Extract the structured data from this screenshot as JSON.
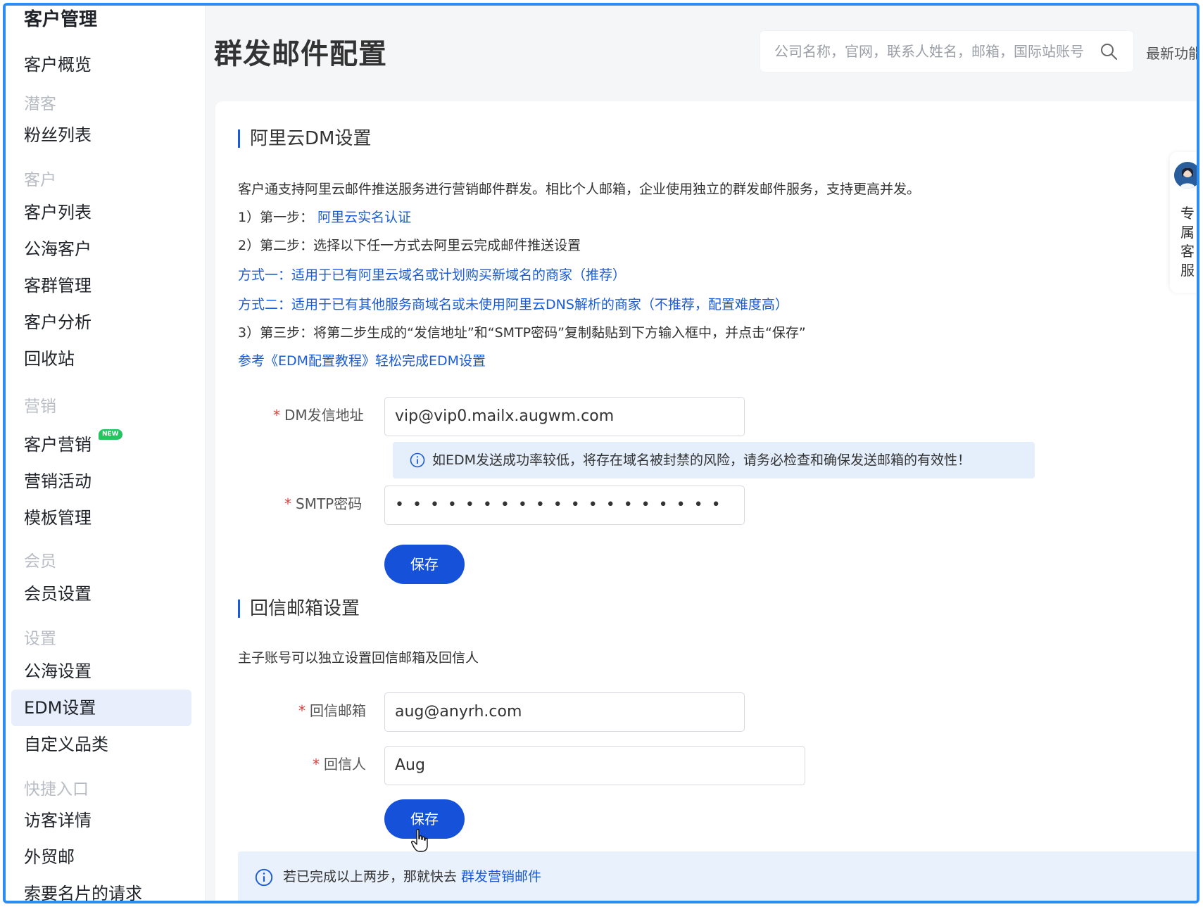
{
  "sidebar": {
    "top_title": "客户管理",
    "overview": "客户概览",
    "groups": {
      "prospects": "潜客",
      "customers": "客户",
      "marketing": "营销",
      "members": "会员",
      "settings": "设置",
      "shortcuts": "快捷入口"
    },
    "items": {
      "fans": "粉丝列表",
      "customer_list": "客户列表",
      "public_customers": "公海客户",
      "group_management": "客群管理",
      "customer_analysis": "客户分析",
      "recycle_bin": "回收站",
      "customer_marketing": "客户营销",
      "new_badge": "NEW",
      "marketing_activities": "营销活动",
      "template_management": "模板管理",
      "member_settings": "会员设置",
      "public_settings": "公海设置",
      "edm_settings": "EDM设置",
      "custom_category": "自定义品类",
      "visitor_details": "访客详情",
      "foreign_trade_mail": "外贸邮",
      "card_requests": "索要名片的请求"
    }
  },
  "header": {
    "title": "群发邮件配置",
    "search_placeholder": "公司名称，官网，联系人姓名，邮箱，国际站账号",
    "new_features": "最新功能"
  },
  "dm_section": {
    "title": "阿里云DM设置",
    "intro": "客户通支持阿里云邮件推送服务进行营销邮件群发。相比个人邮箱，企业使用独立的群发邮件服务，支持更高并发。",
    "step1_prefix": "1）第一步：",
    "step1_link": "阿里云实名认证",
    "step2": "2）第二步：选择以下任一方式去阿里云完成邮件推送设置",
    "method1": "方式一：适用于已有阿里云域名或计划购买新域名的商家（推荐）",
    "method2": "方式二：适用于已有其他服务商域名或未使用阿里云DNS解析的商家（不推荐，配置难度高）",
    "step3": "3）第三步：将第二步生成的“发信地址”和“SMTP密码”复制黏贴到下方输入框中，并点击“保存”",
    "tutorial_link": "参考《EDM配置教程》轻松完成EDM设置",
    "sender_label": "DM发信地址",
    "sender_value": "vip@vip0.mailx.augwm.com",
    "tip": "如EDM发送成功率较低，将存在域名被封禁的风险，请务必检查和确保发送邮箱的有效性！",
    "smtp_label": "SMTP密码",
    "smtp_value": "•••••••••••••••••••",
    "save_label": "保存",
    "required_mark": "*"
  },
  "reply_section": {
    "title": "回信邮箱设置",
    "intro": "主子账号可以独立设置回信邮箱及回信人",
    "email_label": "回信邮箱",
    "email_value": "aug@anyrh.com",
    "sender_label": "回信人",
    "sender_value": "Aug",
    "save_label": "保存"
  },
  "bottom_tip": {
    "text": "若已完成以上两步，那就快去 ",
    "link": "群发营销邮件"
  },
  "service": {
    "label": "专属客服"
  },
  "colors": {
    "accent": "#1652d9",
    "link": "#1a5bd6",
    "required": "#e63838",
    "frame": "#2b8cf2",
    "tip_bg": "#e5effc",
    "active_bg": "#e8eefb"
  }
}
